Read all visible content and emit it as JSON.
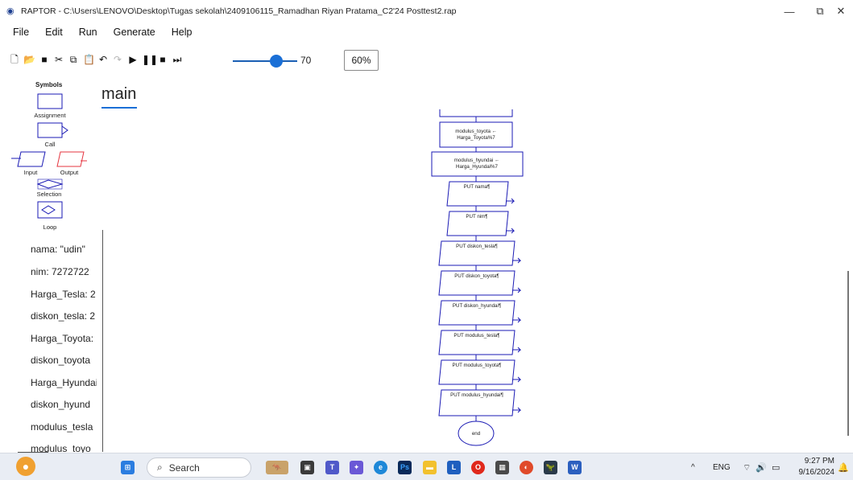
{
  "window": {
    "title": "RAPTOR - C:\\Users\\LENOVO\\Desktop\\Tugas sekolah\\2409106115_Ramadhan Riyan Pratama_C2'24 Posttest2.rap",
    "app_icon": "raptor-icon",
    "minimize": "—",
    "restore": "⧉",
    "close": "✕"
  },
  "menu": [
    "File",
    "Edit",
    "Run",
    "Generate",
    "Help"
  ],
  "toolbar": {
    "buttons": [
      "new-file-icon",
      "open-folder-icon",
      "save-icon",
      "cut-icon",
      "copy-icon",
      "paste-icon",
      "undo-icon",
      "redo-icon",
      "play-icon",
      "pause-icon",
      "stop-icon",
      "step-icon"
    ],
    "speed_value": "70",
    "speed_level": 0.7,
    "zoom": "60%"
  },
  "symbols": {
    "title": "Symbols",
    "items": [
      "Assignment",
      "Call",
      "Input",
      "Output",
      "Selection",
      "Loop"
    ]
  },
  "variables": [
    "nama: \"udin\"",
    "nim: 7272722",
    "Harga_Tesla: 2",
    "diskon_tesla: 2",
    "Harga_Toyota:",
    "diskon_toyota",
    "Harga_Hyundai",
    "diskon_hyund",
    "modulus_tesla",
    "modulus_toyo"
  ],
  "tab": {
    "label": "main"
  },
  "flowchart": {
    "assignments": [
      {
        "line1": "modulus_toyota ←",
        "line2": "Harga_Toyota%7"
      },
      {
        "line1": "modulus_hyundai ←",
        "line2": "Harga_Hyundai%7"
      }
    ],
    "outputs": [
      "PUT nama¶",
      "PUT nim¶",
      "PUT diskon_tesla¶",
      "PUT diskon_toyota¶",
      "PUT diskon_hyundai¶",
      "PUT modulus_tesla¶",
      "PUT modulus_toyota¶",
      "PUT modulus_hyundai¶"
    ],
    "end": "end"
  },
  "taskbar": {
    "search_placeholder": "Search",
    "tray": {
      "chevron": "^",
      "lang": "ENG",
      "time": "9:27 PM",
      "date": "9/16/2024"
    }
  },
  "colors": {
    "flow_stroke": "#1a1ab4",
    "output_stroke": "#e5343f",
    "accent": "#1a6fd6"
  }
}
